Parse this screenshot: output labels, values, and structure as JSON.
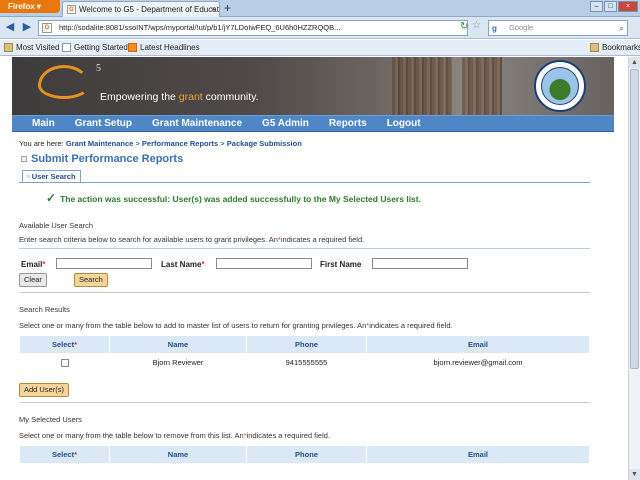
{
  "browser": {
    "app_button": "Firefox",
    "tab_title": "Welcome to G5 - Department of Educati...",
    "url": "http://sodalite:8081/ssoINT/wps/myportal/!ut/p/b1/jY7LDoIwFEQ_6U6h0HZZRQQB...",
    "search_placeholder": "Google",
    "bookmarks": [
      "Most Visited",
      "Getting Started",
      "Latest Headlines"
    ],
    "bookmarks_right": "Bookmarks"
  },
  "banner": {
    "logo_letter": "5",
    "tagline_pre": "Empowering the ",
    "tagline_hl": "grant",
    "tagline_post": " community."
  },
  "menu": [
    "Main",
    "Grant Setup",
    "Grant Maintenance",
    "G5 Admin",
    "Reports",
    "Logout"
  ],
  "breadcrumb": {
    "prefix": "You are here: ",
    "items": [
      "Grant Maintenance",
      "Performance Reports",
      "Package Submission"
    ],
    "sep": " > "
  },
  "page_title": "Submit Performance Reports",
  "subtab": "User Search",
  "success_msg": "The action was successful: User(s) was added successfully to the My Selected Users list.",
  "available": {
    "label": "Available User Search",
    "instr_pre": "Enter search criteria below to search for available users to grant privileges.  An",
    "instr_post": "indicates a required field.",
    "email_label": "Email",
    "last_label": "Last Name",
    "first_label": "First Name",
    "email_value": "",
    "last_value": "",
    "first_value": "",
    "clear_btn": "Clear",
    "search_btn": "Search"
  },
  "results": {
    "label": "Search Results",
    "instr_pre": "Select one or many from the table below to add to master list of users to return for granting privileges.  An",
    "instr_post": "indicates a required field.",
    "columns": [
      "Select",
      "Name",
      "Phone",
      "Email"
    ],
    "rows": [
      {
        "name": "Bjorn Reviewer",
        "phone": "9415555555",
        "email": "bjorn.reviewer@gmail.com"
      }
    ],
    "add_btn": "Add User(s)"
  },
  "selected": {
    "label": "My Selected Users",
    "instr_pre": "Select one or many from the table below to remove from this list.  An",
    "instr_post": "indicates a required field.",
    "columns": [
      "Select",
      "Name",
      "Phone",
      "Email"
    ]
  },
  "colors": {
    "menu_bg": "#4f86c6",
    "accent_orange": "#f0a23a",
    "success_green": "#2b7d2b",
    "required_red": "#d33"
  }
}
